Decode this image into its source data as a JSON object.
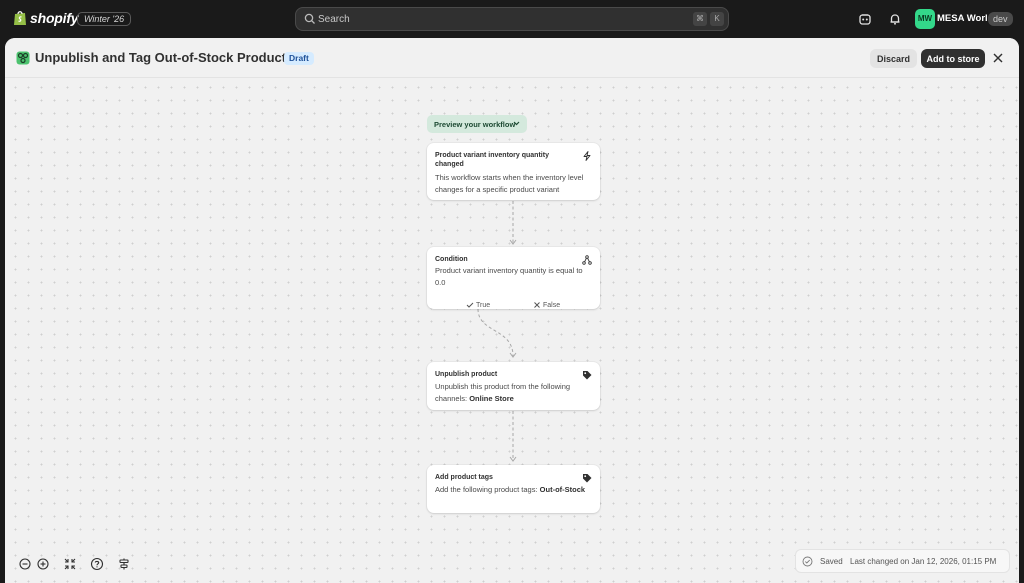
{
  "topbar": {
    "brand": "shopify",
    "edition": "Winter '26",
    "search_placeholder": "Search",
    "shortcut_keys": [
      "⌘",
      "K"
    ],
    "avatar_initials": "MW",
    "store_name": "MESA World",
    "env_badge": "dev",
    "icons": [
      "shopify-bag-icon",
      "search-icon",
      "sidekick-icon",
      "bell-icon"
    ]
  },
  "header": {
    "title": "Unpublish and Tag Out-of-Stock Products",
    "status_badge": "Draft",
    "discard_label": "Discard",
    "add_label": "Add to store"
  },
  "canvas": {
    "preview_label": "Preview your workflow",
    "steps": [
      {
        "title": "Product variant inventory quantity changed",
        "description": "This workflow starts when the inventory level changes for a specific product variant",
        "icon": "lightning-icon"
      },
      {
        "title": "Condition",
        "description": "Product variant inventory quantity is equal to 0.0",
        "icon": "branch-icon",
        "true_label": "True",
        "false_label": "False"
      },
      {
        "title": "Unpublish product",
        "description_prefix": "Unpublish this product from the following channels: ",
        "description_bold": "Online Store",
        "icon": "tag-icon"
      },
      {
        "title": "Add product tags",
        "description_prefix": "Add the following product tags: ",
        "description_bold": "Out-of-Stock",
        "icon": "tag-icon"
      }
    ]
  },
  "footer": {
    "tools": [
      "zoom-out-icon",
      "zoom-in-icon",
      "fit-view-icon",
      "help-icon",
      "layout-icon"
    ],
    "saved_label": "Saved",
    "last_changed": "Last changed on Jan 12, 2026, 01:15 PM"
  },
  "colors": {
    "accent_green": "#33d88a",
    "draft_badge_bg": "#d5ebff",
    "preview_bg": "#d4e9dd"
  }
}
